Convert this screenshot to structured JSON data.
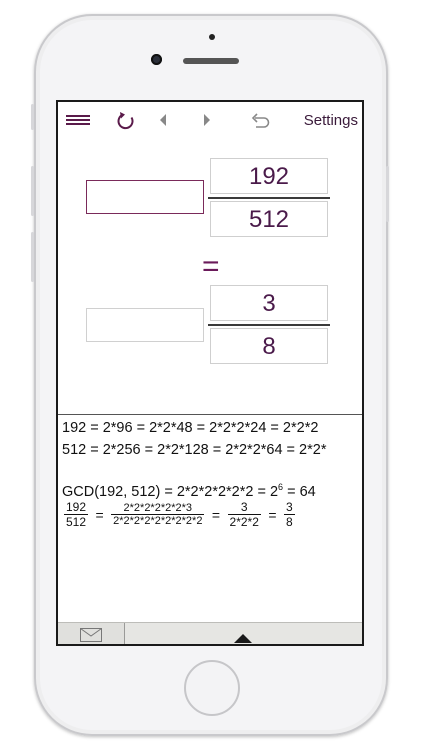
{
  "toolbar": {
    "menu_icon": "hamburger-menu-icon",
    "refresh_icon": "refresh-icon",
    "prev_icon": "triangle-left-icon",
    "next_icon": "triangle-right-icon",
    "undo_icon": "undo-icon",
    "settings_label": "Settings"
  },
  "fraction_input": {
    "numerator": "192",
    "denominator": "512"
  },
  "equals_sign": "=",
  "fraction_result": {
    "numerator": "3",
    "denominator": "8"
  },
  "solution": {
    "line1": "192 = 2*96 = 2*2*48 = 2*2*2*24 = 2*2*2",
    "line2": "512 = 2*256 = 2*2*128 = 2*2*2*64 = 2*2*",
    "gcd_prefix": "GCD(192, 512) = 2*2*2*2*2*2 = 2",
    "gcd_exp": "6",
    "gcd_suffix": " = 64",
    "step_frac1_num": "192",
    "step_frac1_den": "512",
    "step_frac2_num": "2*2*2*2*2*2*3",
    "step_frac2_den": "2*2*2*2*2*2*2*2*2",
    "step_frac3_num": "3",
    "step_frac3_den": "2*2*2",
    "step_frac4_num": "3",
    "step_frac4_den": "8",
    "eq": "="
  },
  "bottom_bar": {
    "mail_icon": "envelope-icon",
    "expand_icon": "triangle-up-icon"
  },
  "colors": {
    "accent": "#5a1a4a",
    "text_purple": "#4a1a4a",
    "bar": "#e6e6e3"
  }
}
